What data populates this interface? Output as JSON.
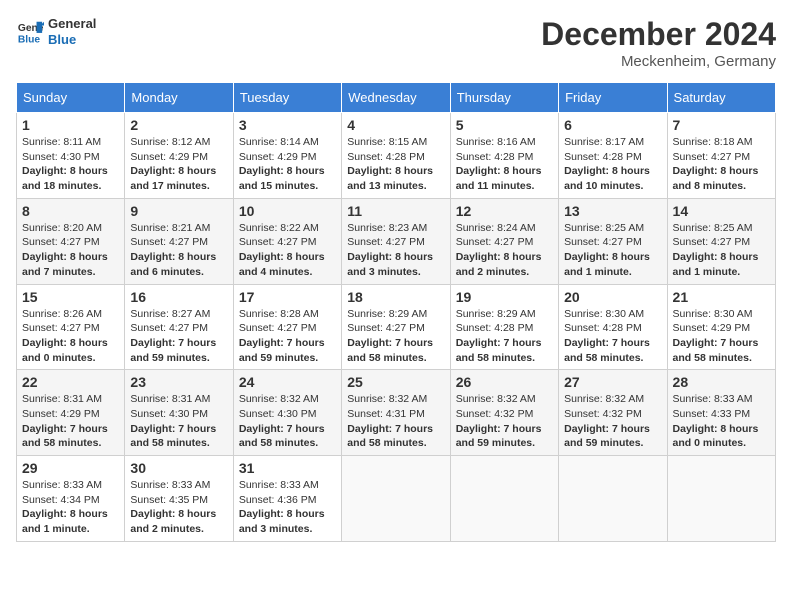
{
  "header": {
    "logo_line1": "General",
    "logo_line2": "Blue",
    "month_year": "December 2024",
    "location": "Meckenheim, Germany"
  },
  "days_of_week": [
    "Sunday",
    "Monday",
    "Tuesday",
    "Wednesday",
    "Thursday",
    "Friday",
    "Saturday"
  ],
  "weeks": [
    [
      {
        "day": "1",
        "info": "Sunrise: 8:11 AM\nSunset: 4:30 PM\nDaylight: 8 hours and 18 minutes."
      },
      {
        "day": "2",
        "info": "Sunrise: 8:12 AM\nSunset: 4:29 PM\nDaylight: 8 hours and 17 minutes."
      },
      {
        "day": "3",
        "info": "Sunrise: 8:14 AM\nSunset: 4:29 PM\nDaylight: 8 hours and 15 minutes."
      },
      {
        "day": "4",
        "info": "Sunrise: 8:15 AM\nSunset: 4:28 PM\nDaylight: 8 hours and 13 minutes."
      },
      {
        "day": "5",
        "info": "Sunrise: 8:16 AM\nSunset: 4:28 PM\nDaylight: 8 hours and 11 minutes."
      },
      {
        "day": "6",
        "info": "Sunrise: 8:17 AM\nSunset: 4:28 PM\nDaylight: 8 hours and 10 minutes."
      },
      {
        "day": "7",
        "info": "Sunrise: 8:18 AM\nSunset: 4:27 PM\nDaylight: 8 hours and 8 minutes."
      }
    ],
    [
      {
        "day": "8",
        "info": "Sunrise: 8:20 AM\nSunset: 4:27 PM\nDaylight: 8 hours and 7 minutes."
      },
      {
        "day": "9",
        "info": "Sunrise: 8:21 AM\nSunset: 4:27 PM\nDaylight: 8 hours and 6 minutes."
      },
      {
        "day": "10",
        "info": "Sunrise: 8:22 AM\nSunset: 4:27 PM\nDaylight: 8 hours and 4 minutes."
      },
      {
        "day": "11",
        "info": "Sunrise: 8:23 AM\nSunset: 4:27 PM\nDaylight: 8 hours and 3 minutes."
      },
      {
        "day": "12",
        "info": "Sunrise: 8:24 AM\nSunset: 4:27 PM\nDaylight: 8 hours and 2 minutes."
      },
      {
        "day": "13",
        "info": "Sunrise: 8:25 AM\nSunset: 4:27 PM\nDaylight: 8 hours and 1 minute."
      },
      {
        "day": "14",
        "info": "Sunrise: 8:25 AM\nSunset: 4:27 PM\nDaylight: 8 hours and 1 minute."
      }
    ],
    [
      {
        "day": "15",
        "info": "Sunrise: 8:26 AM\nSunset: 4:27 PM\nDaylight: 8 hours and 0 minutes."
      },
      {
        "day": "16",
        "info": "Sunrise: 8:27 AM\nSunset: 4:27 PM\nDaylight: 7 hours and 59 minutes."
      },
      {
        "day": "17",
        "info": "Sunrise: 8:28 AM\nSunset: 4:27 PM\nDaylight: 7 hours and 59 minutes."
      },
      {
        "day": "18",
        "info": "Sunrise: 8:29 AM\nSunset: 4:27 PM\nDaylight: 7 hours and 58 minutes."
      },
      {
        "day": "19",
        "info": "Sunrise: 8:29 AM\nSunset: 4:28 PM\nDaylight: 7 hours and 58 minutes."
      },
      {
        "day": "20",
        "info": "Sunrise: 8:30 AM\nSunset: 4:28 PM\nDaylight: 7 hours and 58 minutes."
      },
      {
        "day": "21",
        "info": "Sunrise: 8:30 AM\nSunset: 4:29 PM\nDaylight: 7 hours and 58 minutes."
      }
    ],
    [
      {
        "day": "22",
        "info": "Sunrise: 8:31 AM\nSunset: 4:29 PM\nDaylight: 7 hours and 58 minutes."
      },
      {
        "day": "23",
        "info": "Sunrise: 8:31 AM\nSunset: 4:30 PM\nDaylight: 7 hours and 58 minutes."
      },
      {
        "day": "24",
        "info": "Sunrise: 8:32 AM\nSunset: 4:30 PM\nDaylight: 7 hours and 58 minutes."
      },
      {
        "day": "25",
        "info": "Sunrise: 8:32 AM\nSunset: 4:31 PM\nDaylight: 7 hours and 58 minutes."
      },
      {
        "day": "26",
        "info": "Sunrise: 8:32 AM\nSunset: 4:32 PM\nDaylight: 7 hours and 59 minutes."
      },
      {
        "day": "27",
        "info": "Sunrise: 8:32 AM\nSunset: 4:32 PM\nDaylight: 7 hours and 59 minutes."
      },
      {
        "day": "28",
        "info": "Sunrise: 8:33 AM\nSunset: 4:33 PM\nDaylight: 8 hours and 0 minutes."
      }
    ],
    [
      {
        "day": "29",
        "info": "Sunrise: 8:33 AM\nSunset: 4:34 PM\nDaylight: 8 hours and 1 minute."
      },
      {
        "day": "30",
        "info": "Sunrise: 8:33 AM\nSunset: 4:35 PM\nDaylight: 8 hours and 2 minutes."
      },
      {
        "day": "31",
        "info": "Sunrise: 8:33 AM\nSunset: 4:36 PM\nDaylight: 8 hours and 3 minutes."
      },
      null,
      null,
      null,
      null
    ]
  ]
}
